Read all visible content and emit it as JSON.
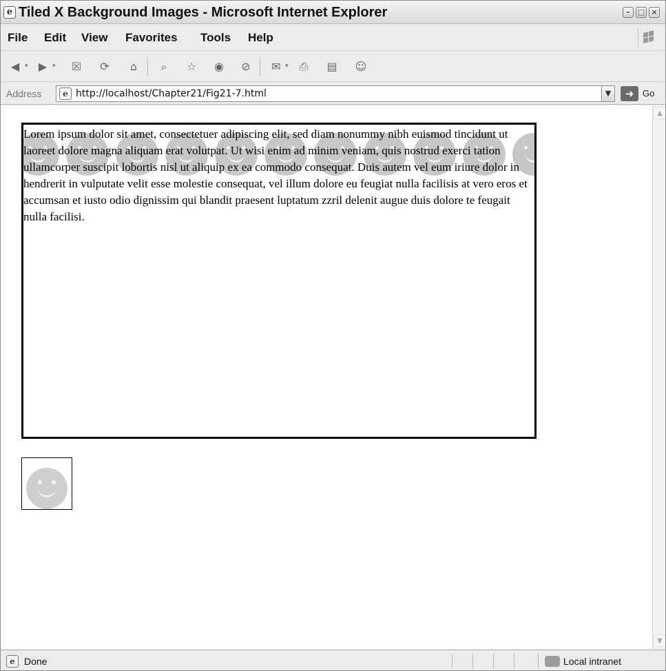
{
  "window": {
    "title": "Tiled X Background Images - Microsoft Internet Explorer",
    "controls": {
      "minimize": "–",
      "maximize": "□",
      "close": "×"
    }
  },
  "menu": {
    "items": [
      "File",
      "Edit",
      "View",
      "Favorites",
      "Tools",
      "Help"
    ]
  },
  "toolbar": {
    "icons": [
      "back-icon",
      "forward-icon",
      "stop-icon",
      "refresh-icon",
      "home-icon",
      "search-icon",
      "favorites-icon",
      "media-icon",
      "history-icon",
      "mail-icon",
      "print-icon",
      "edit-icon",
      "messenger-icon"
    ]
  },
  "address_bar": {
    "label": "Address",
    "url": "http://localhost/Chapter21/Fig21-7.html",
    "go_label": "Go"
  },
  "page": {
    "paragraph": "Lorem ipsum dolor sit amet, consectetuer adipiscing elit, sed diam nonummy nibh euismod tincidunt ut laoreet dolore magna aliquam erat volutpat. Ut wisi enim ad minim veniam, quis nostrud exerci tation ullamcorper suscipit lobortis nisl ut aliquip ex ea commodo consequat. Duis autem vel eum iriure dolor in hendrerit in vulputate velit esse molestie consequat, vel illum dolore eu feugiat nulla facilisis at vero eros et accumsan et iusto odio dignissim qui blandit praesent luptatum zzril delenit augue duis dolore te feugait nulla facilisi.",
    "tiled_icon": "smiley-face-icon",
    "single_icon": "smiley-face-icon"
  },
  "status_bar": {
    "status": "Done",
    "zone": "Local intranet"
  }
}
